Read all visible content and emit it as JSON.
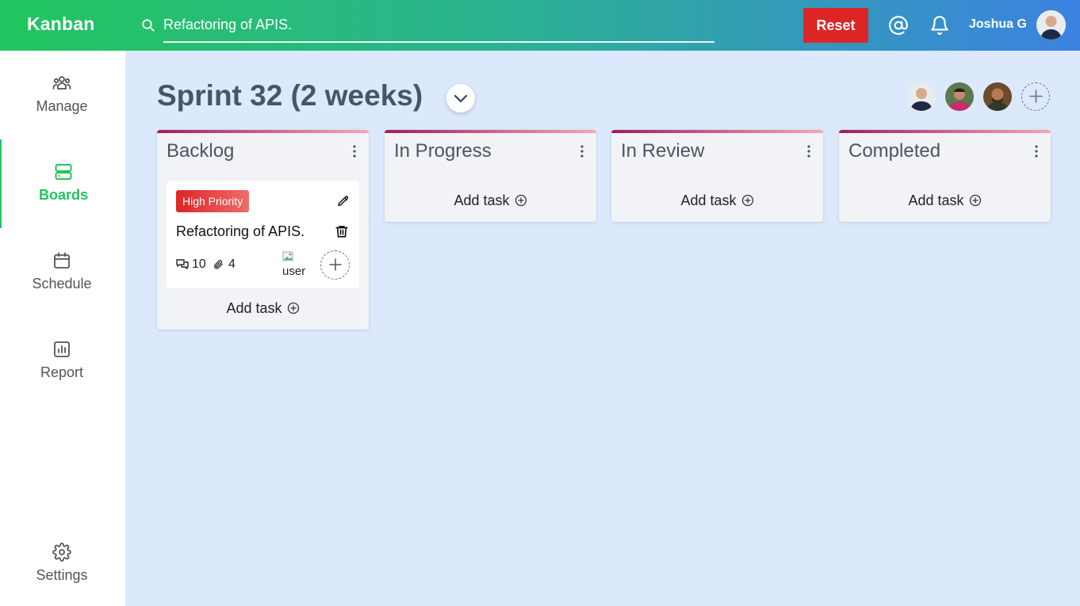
{
  "header": {
    "logo": "Kanban",
    "search_value": "Refactoring of APIS.",
    "reset_label": "Reset",
    "user_name": "Joshua G"
  },
  "sidebar": {
    "items": [
      {
        "label": "Manage",
        "icon": "team-icon"
      },
      {
        "label": "Boards",
        "icon": "boards-icon",
        "active": true
      },
      {
        "label": "Schedule",
        "icon": "calendar-icon"
      },
      {
        "label": "Report",
        "icon": "report-icon"
      },
      {
        "label": "Settings",
        "icon": "gear-icon"
      }
    ]
  },
  "board": {
    "title": "Sprint 32 (2 weeks)",
    "add_task_label": "Add task",
    "columns": [
      {
        "title": "Backlog"
      },
      {
        "title": "In Progress"
      },
      {
        "title": "In Review"
      },
      {
        "title": "Completed"
      }
    ],
    "task": {
      "priority": "High Priority",
      "title": "Refactoring of APIS.",
      "comments": "10",
      "attachments": "4",
      "assignee_alt": "user"
    }
  },
  "colors": {
    "accent": "#22c55e",
    "reset": "#dc2626",
    "background": "#dce9fc",
    "column_bar_start": "#a21d5a",
    "column_bar_end": "#f4a7b6"
  }
}
